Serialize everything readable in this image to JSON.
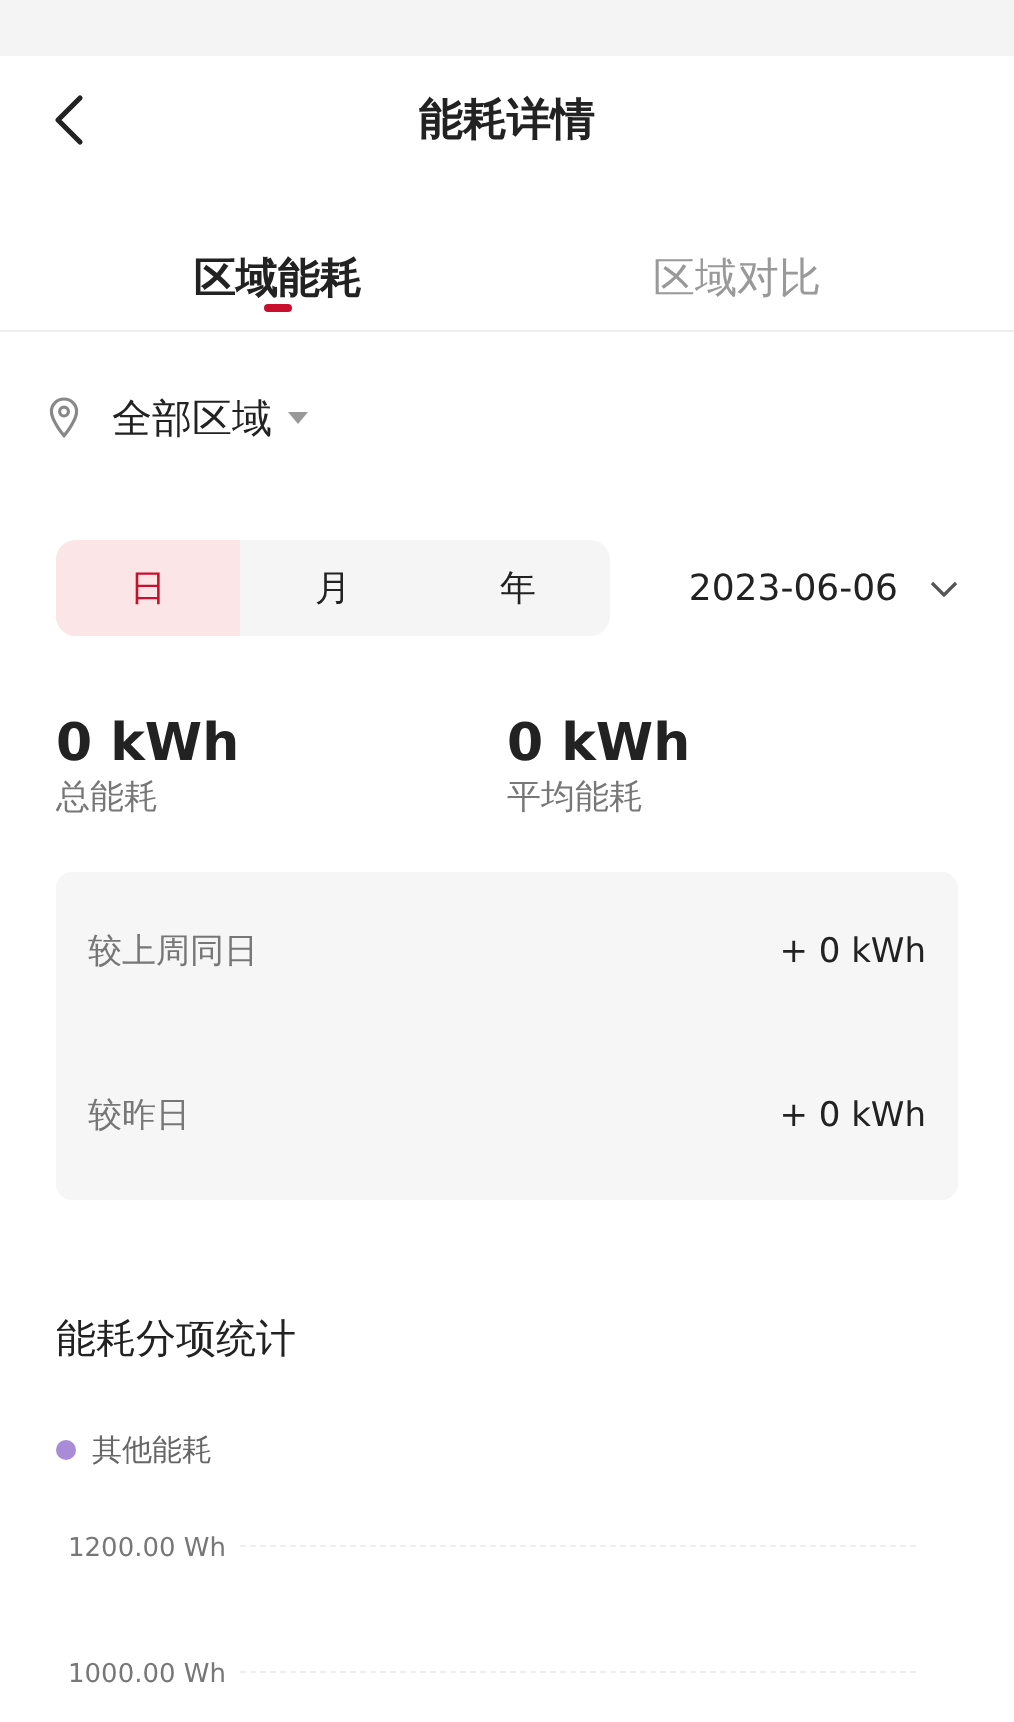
{
  "header": {
    "title": "能耗详情"
  },
  "tabs": [
    {
      "label": "区域能耗",
      "selected": true
    },
    {
      "label": "区域对比",
      "selected": false
    }
  ],
  "region": {
    "label": "全部区域"
  },
  "period_tabs": [
    {
      "label": "日",
      "selected": true
    },
    {
      "label": "月",
      "selected": false
    },
    {
      "label": "年",
      "selected": false
    }
  ],
  "date": "2023-06-06",
  "stats": [
    {
      "value": "0 kWh",
      "label": "总能耗"
    },
    {
      "value": "0 kWh",
      "label": "平均能耗"
    }
  ],
  "comparisons": [
    {
      "label": "较上周同日",
      "value": "+ 0 kWh"
    },
    {
      "label": "较昨日",
      "value": "+ 0 kWh"
    }
  ],
  "section_title": "能耗分项统计",
  "chart_data": {
    "type": "bar",
    "series": [
      {
        "name": "其他能耗",
        "color": "#a98bd8"
      }
    ],
    "ylim": [
      1000,
      1200
    ],
    "yticks": [
      {
        "value": 1200,
        "label": "1200.00 Wh"
      },
      {
        "value": 1000,
        "label": "1000.00 Wh"
      }
    ]
  }
}
